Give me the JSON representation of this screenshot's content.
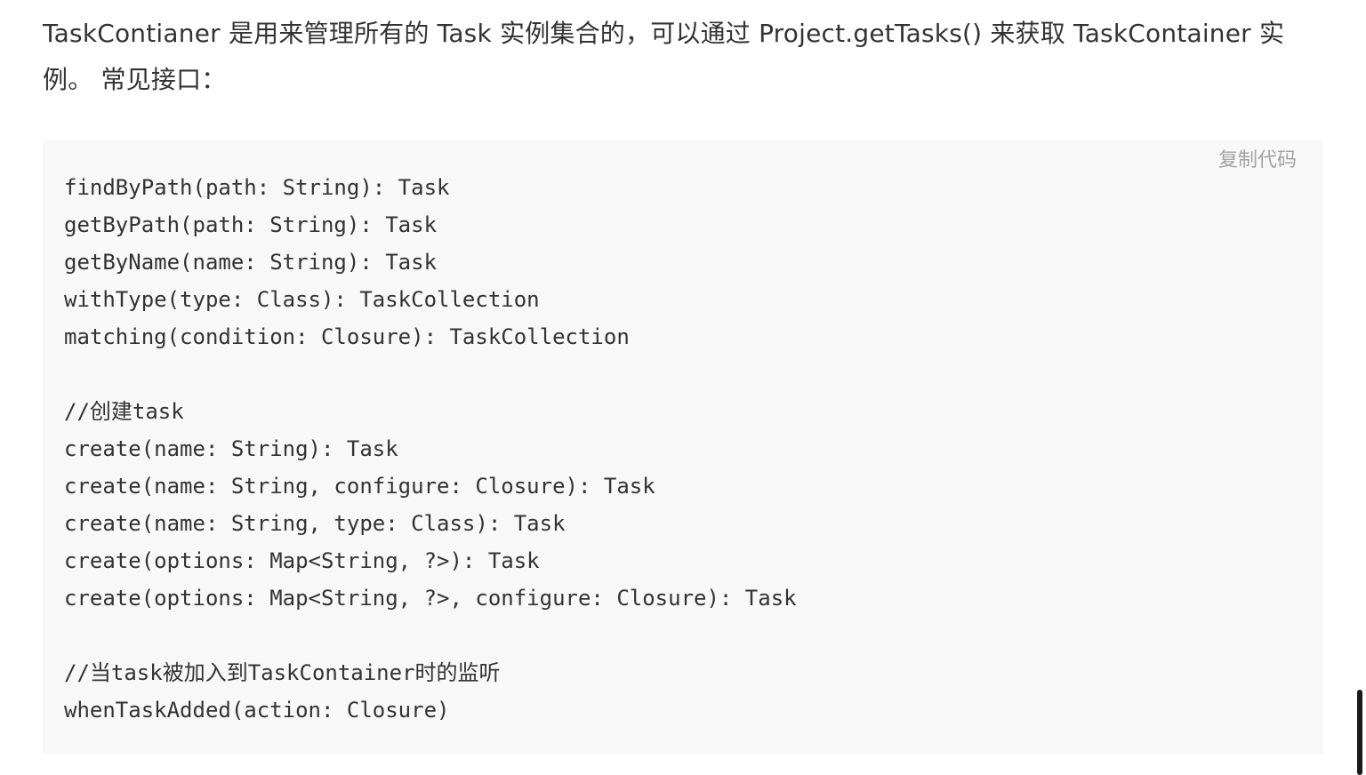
{
  "intro": {
    "text": "TaskContianer 是用来管理所有的 Task 实例集合的，可以通过 Project.getTasks() 来获取 TaskContainer 实例。 常见接口："
  },
  "code_block": {
    "copy_label": "复制代码",
    "lines": [
      "findByPath(path: String): Task",
      "getByPath(path: String): Task",
      "getByName(name: String): Task",
      "withType(type: Class): TaskCollection",
      "matching(condition: Closure): TaskCollection",
      "",
      "//创建task",
      "create(name: String): Task",
      "create(name: String, configure: Closure): Task",
      "create(name: String, type: Class): Task",
      "create(options: Map<String, ?>): Task",
      "create(options: Map<String, ?>, configure: Closure): Task",
      "",
      "//当task被加入到TaskContainer时的监听",
      "whenTaskAdded(action: Closure)"
    ]
  }
}
